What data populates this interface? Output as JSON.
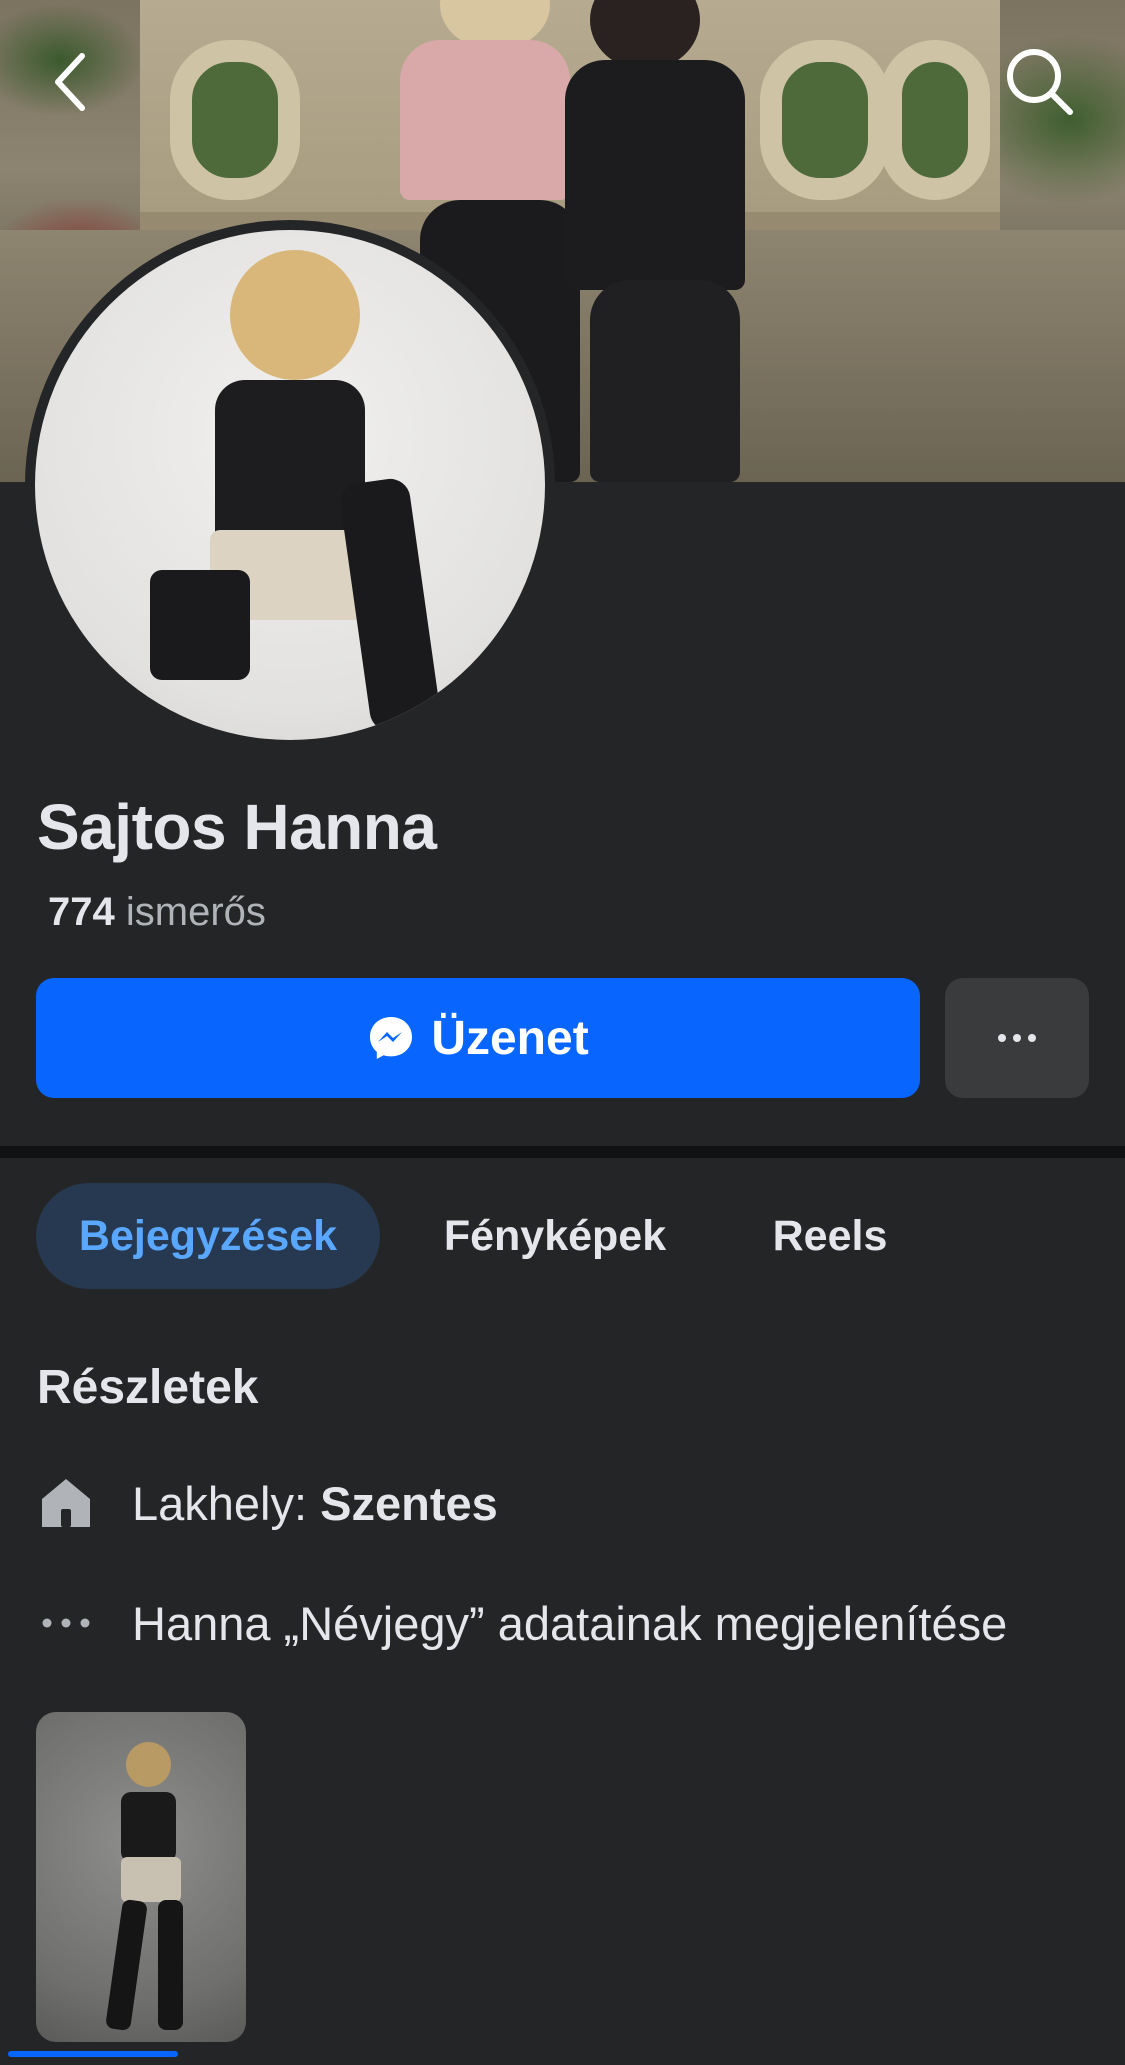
{
  "profile": {
    "name": "Sajtos Hanna",
    "friends_count": "774",
    "friends_label": "ismerős"
  },
  "actions": {
    "message_label": "Üzenet",
    "more_label": "…"
  },
  "tabs": [
    {
      "label": "Bejegyzések",
      "active": true
    },
    {
      "label": "Fényképek",
      "active": false
    },
    {
      "label": "Reels",
      "active": false
    }
  ],
  "details": {
    "title": "Részletek",
    "residence_label": "Lakhely:",
    "residence_value": "Szentes",
    "about_link": "Hanna „Névjegy” adatainak megjelenítése"
  },
  "icons": {
    "back": "chevron-left-icon",
    "search": "search-icon",
    "messenger": "messenger-icon",
    "more": "ellipsis-icon",
    "home": "home-icon",
    "about": "ellipsis-icon"
  },
  "colors": {
    "background": "#242527",
    "primary": "#0866ff",
    "active_tab_bg": "#263951",
    "active_tab_text": "#5aa7ff",
    "secondary_button": "#3a3b3c",
    "muted_text": "#b0b3b8"
  }
}
